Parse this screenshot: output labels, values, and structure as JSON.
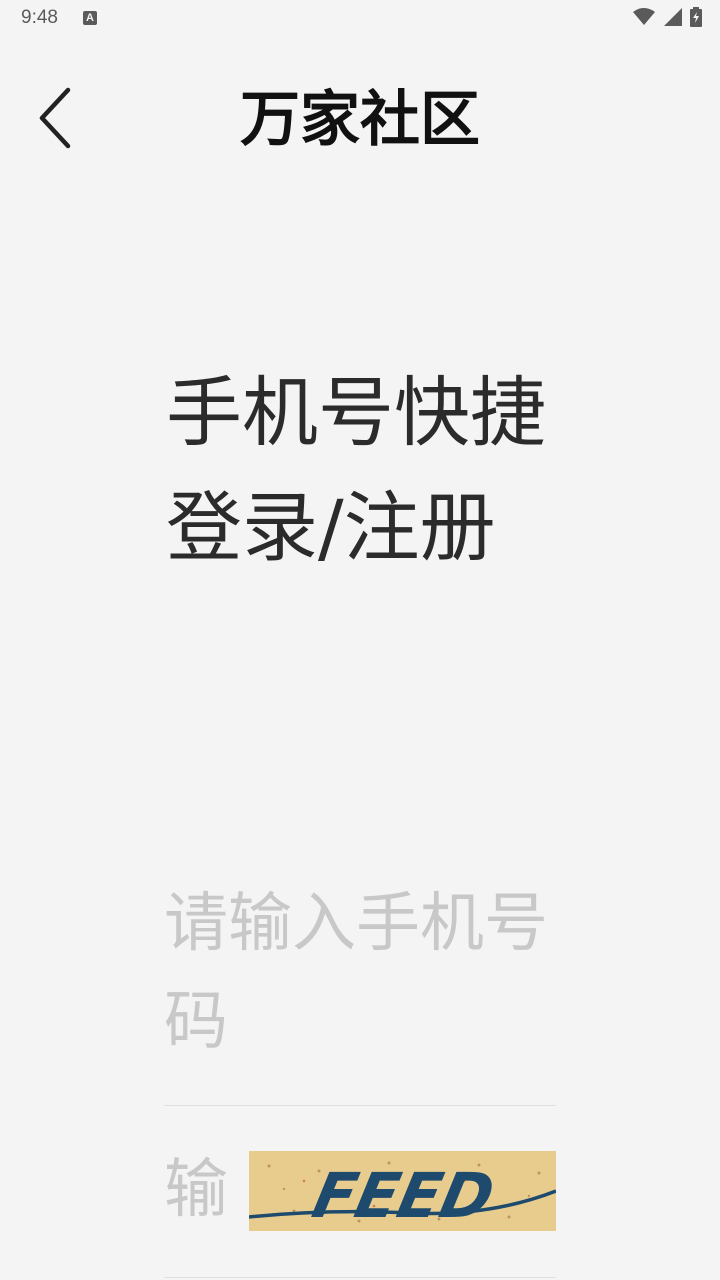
{
  "status_bar": {
    "time": "9:48",
    "notification_icon": "A"
  },
  "header": {
    "title": "万家社区"
  },
  "login": {
    "heading": "手机号快捷登录/注册",
    "phone_placeholder": "请输入手机号码",
    "captcha_placeholder": "输",
    "captcha_text": "FEED"
  },
  "colors": {
    "background": "#f4f4f4",
    "captcha_bg": "#e8cc8e",
    "captcha_text": "#1e4a6e",
    "placeholder": "#c8c8c8"
  }
}
